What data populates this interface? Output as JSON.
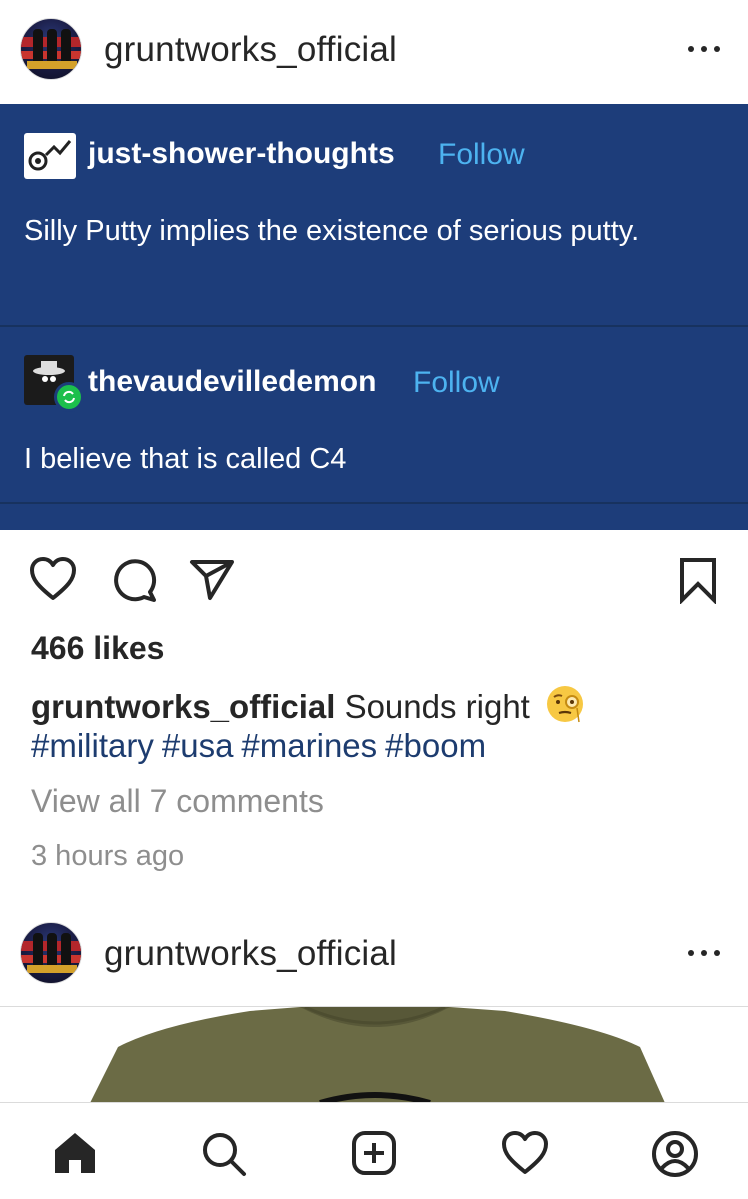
{
  "post1": {
    "username": "gruntworks_official",
    "tumblr": {
      "post_author": "just-shower-thoughts",
      "post_follow": "Follow",
      "post_text": "Silly Putty implies the existence of serious putty.",
      "reblog_author": "thevaudevilledemon",
      "reblog_follow": "Follow",
      "reblog_text": "I believe that is called C4"
    },
    "likes": "466 likes",
    "caption_user": "gruntworks_official",
    "caption_text": "Sounds right",
    "hashtags": [
      "#military",
      "#usa",
      "#marines",
      "#boom"
    ],
    "view_comments": "View all 7 comments",
    "time_ago": "3 hours ago"
  },
  "post2": {
    "username": "gruntworks_official"
  },
  "colors": {
    "tumblr_bg": "#1d3d7a",
    "link_blue": "#4db3f0",
    "hashtag": "#1d3c6f",
    "muted": "#8e8e8e",
    "shirt": "#6b6b45"
  },
  "icons": {
    "actions": [
      "heart-icon",
      "comment-icon",
      "share-icon",
      "bookmark-icon"
    ],
    "nav": [
      "home-icon",
      "search-icon",
      "new-post-icon",
      "activity-icon",
      "profile-icon"
    ]
  }
}
